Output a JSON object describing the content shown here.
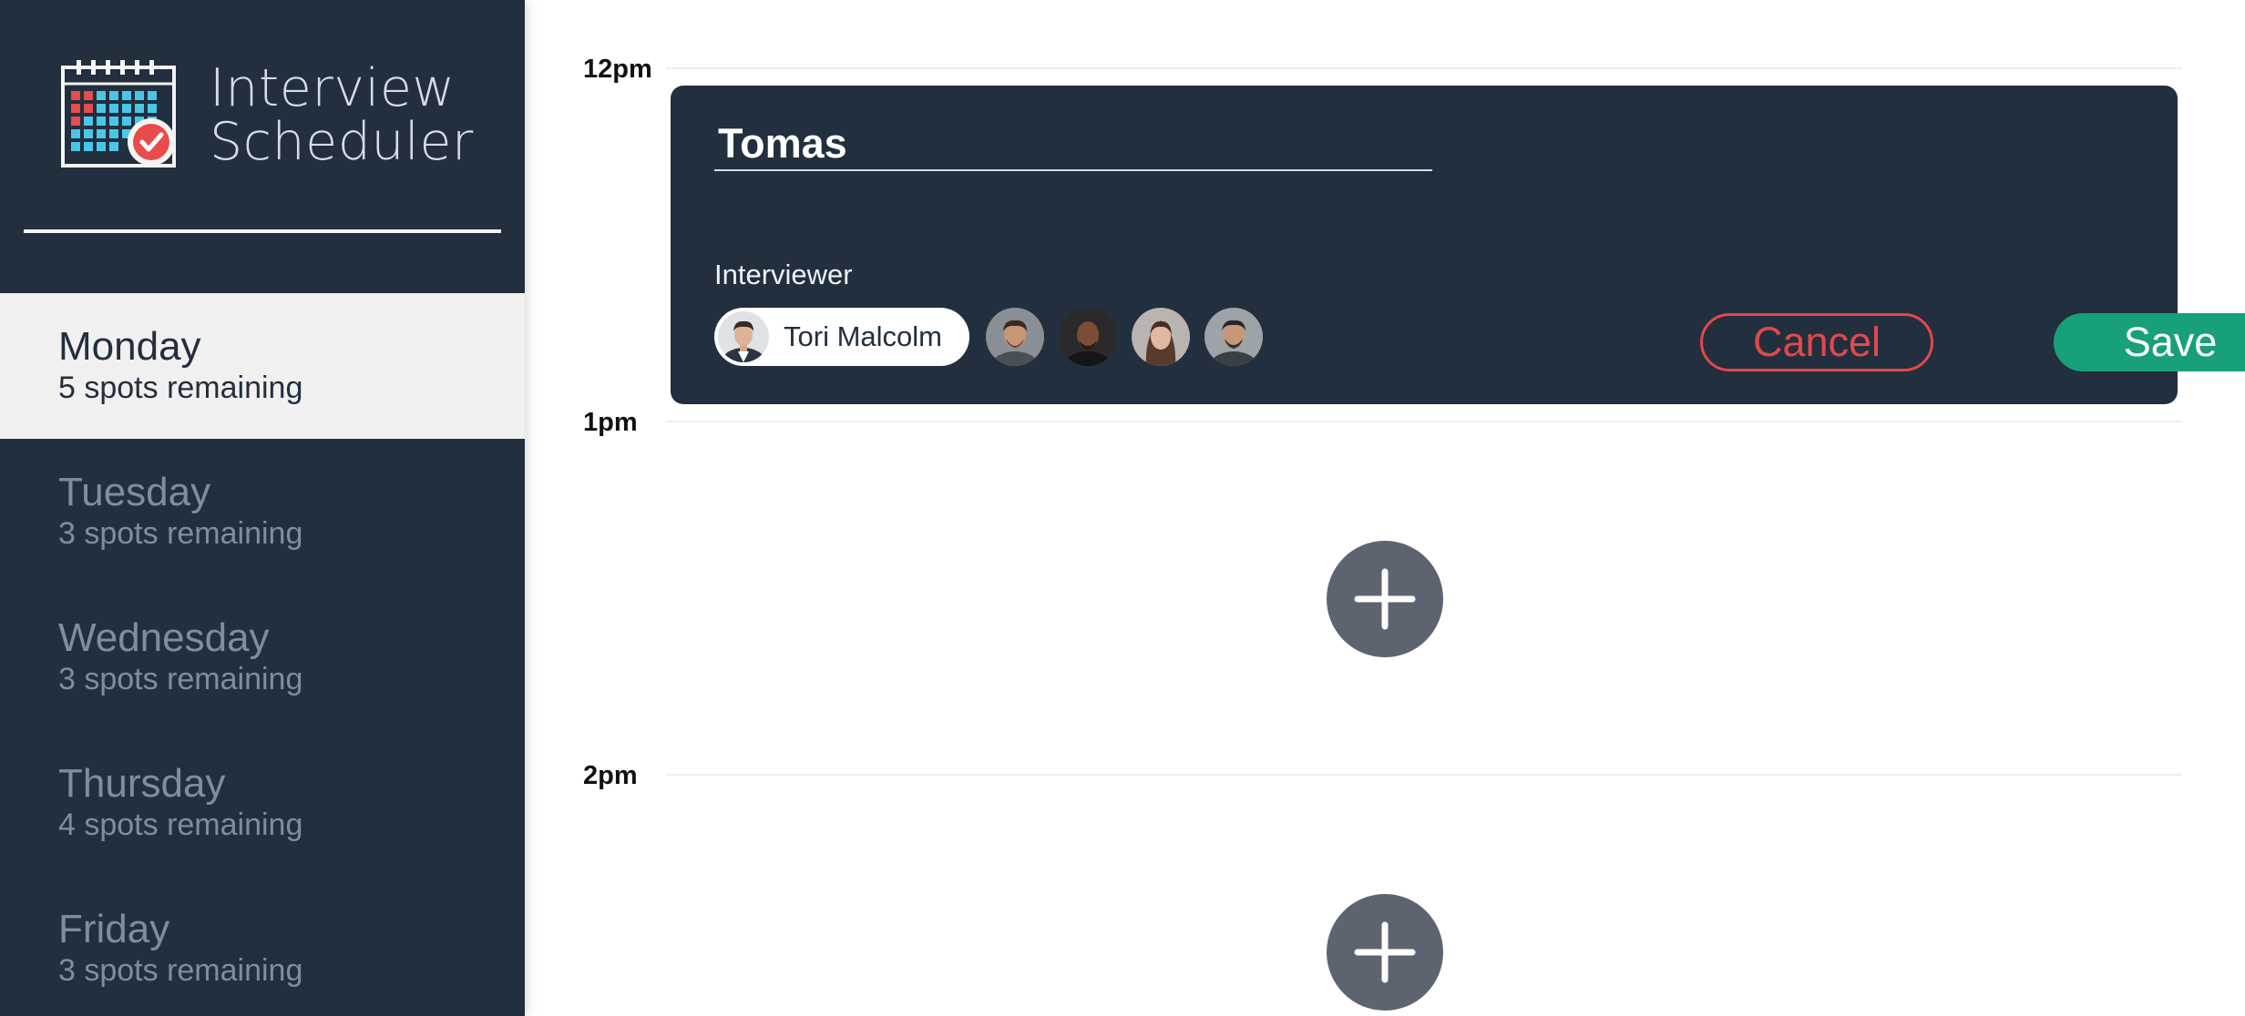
{
  "brand": {
    "line1": "Interview",
    "line2": "Scheduler",
    "icon": "calendar-check-icon"
  },
  "days": [
    {
      "name": "Monday",
      "spots": "5 spots remaining",
      "selected": true
    },
    {
      "name": "Tuesday",
      "spots": "3 spots remaining",
      "selected": false
    },
    {
      "name": "Wednesday",
      "spots": "3 spots remaining",
      "selected": false
    },
    {
      "name": "Thursday",
      "spots": "4 spots remaining",
      "selected": false
    },
    {
      "name": "Friday",
      "spots": "3 spots remaining",
      "selected": false
    }
  ],
  "slots": [
    {
      "time": "12pm"
    },
    {
      "time": "1pm"
    },
    {
      "time": "2pm"
    }
  ],
  "form": {
    "student_name": "Tomas",
    "interviewer_label": "Interviewer",
    "selected_interviewer": "Tori Malcolm",
    "cancel_label": "Cancel",
    "save_label": "Save"
  },
  "add_button_icon": "plus-icon",
  "colors": {
    "sidebar": "#222f3e",
    "selected_day_bg": "#f0f0f0",
    "cancel": "#e2484b",
    "save": "#17a07a",
    "add_button": "#5c6470"
  }
}
